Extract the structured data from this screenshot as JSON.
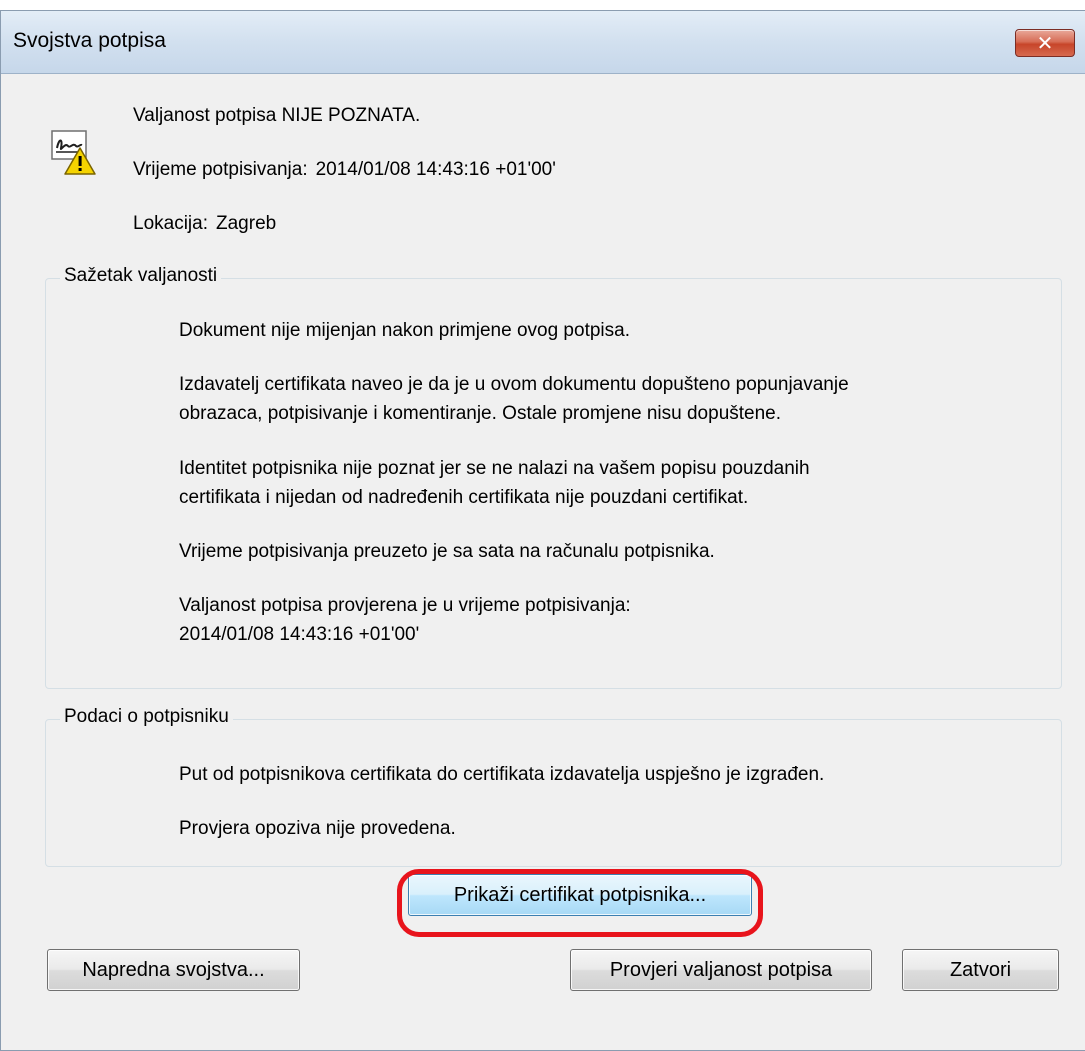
{
  "window": {
    "title": "Svojstva potpisa",
    "close_icon": "close-icon"
  },
  "header": {
    "status": "Valjanost potpisa NIJE POZNATA.",
    "signing_time_label": "Vrijeme potpisivanja:",
    "signing_time_value": "2014/01/08 14:43:16 +01'00'",
    "location_label": "Lokacija:",
    "location_value": "Zagreb",
    "icon": "signature-warning-icon"
  },
  "validity_summary": {
    "legend": "Sažetak valjanosti",
    "p1": "Dokument nije mijenjan nakon primjene ovog potpisa.",
    "p2_line1": "Izdavatelj certifikata naveo je da je u ovom dokumentu dopušteno popunjavanje",
    "p2_line2": "obrazaca, potpisivanje i komentiranje.  Ostale promjene nisu dopuštene.",
    "p3_line1": "Identitet potpisnika nije poznat jer se ne nalazi na vašem popisu pouzdanih",
    "p3_line2": "certifikata i nijedan od nadređenih certifikata nije pouzdani certifikat.",
    "p4": "Vrijeme potpisivanja preuzeto je sa sata na računalu potpisnika.",
    "p5_line1": "Valjanost potpisa provjerena je u vrijeme potpisivanja:",
    "p5_line2": "2014/01/08 14:43:16 +01'00'"
  },
  "signer_info": {
    "legend": "Podaci o potpisniku",
    "p1": "Put od potpisnikova certifikata do certifikata izdavatelja uspješno je izgrađen.",
    "p2": "Provjera opoziva nije provedena.",
    "show_certificate_label": "Prikaži certifikat potpisnika..."
  },
  "footer": {
    "advanced_label": "Napredna svojstva...",
    "validate_label": "Provjeri valjanost potpisa",
    "close_label": "Zatvori"
  },
  "colors": {
    "highlight": "#e8141c",
    "dialog_bg": "#f0f0f0",
    "titlebar": "#d2e0ef"
  }
}
